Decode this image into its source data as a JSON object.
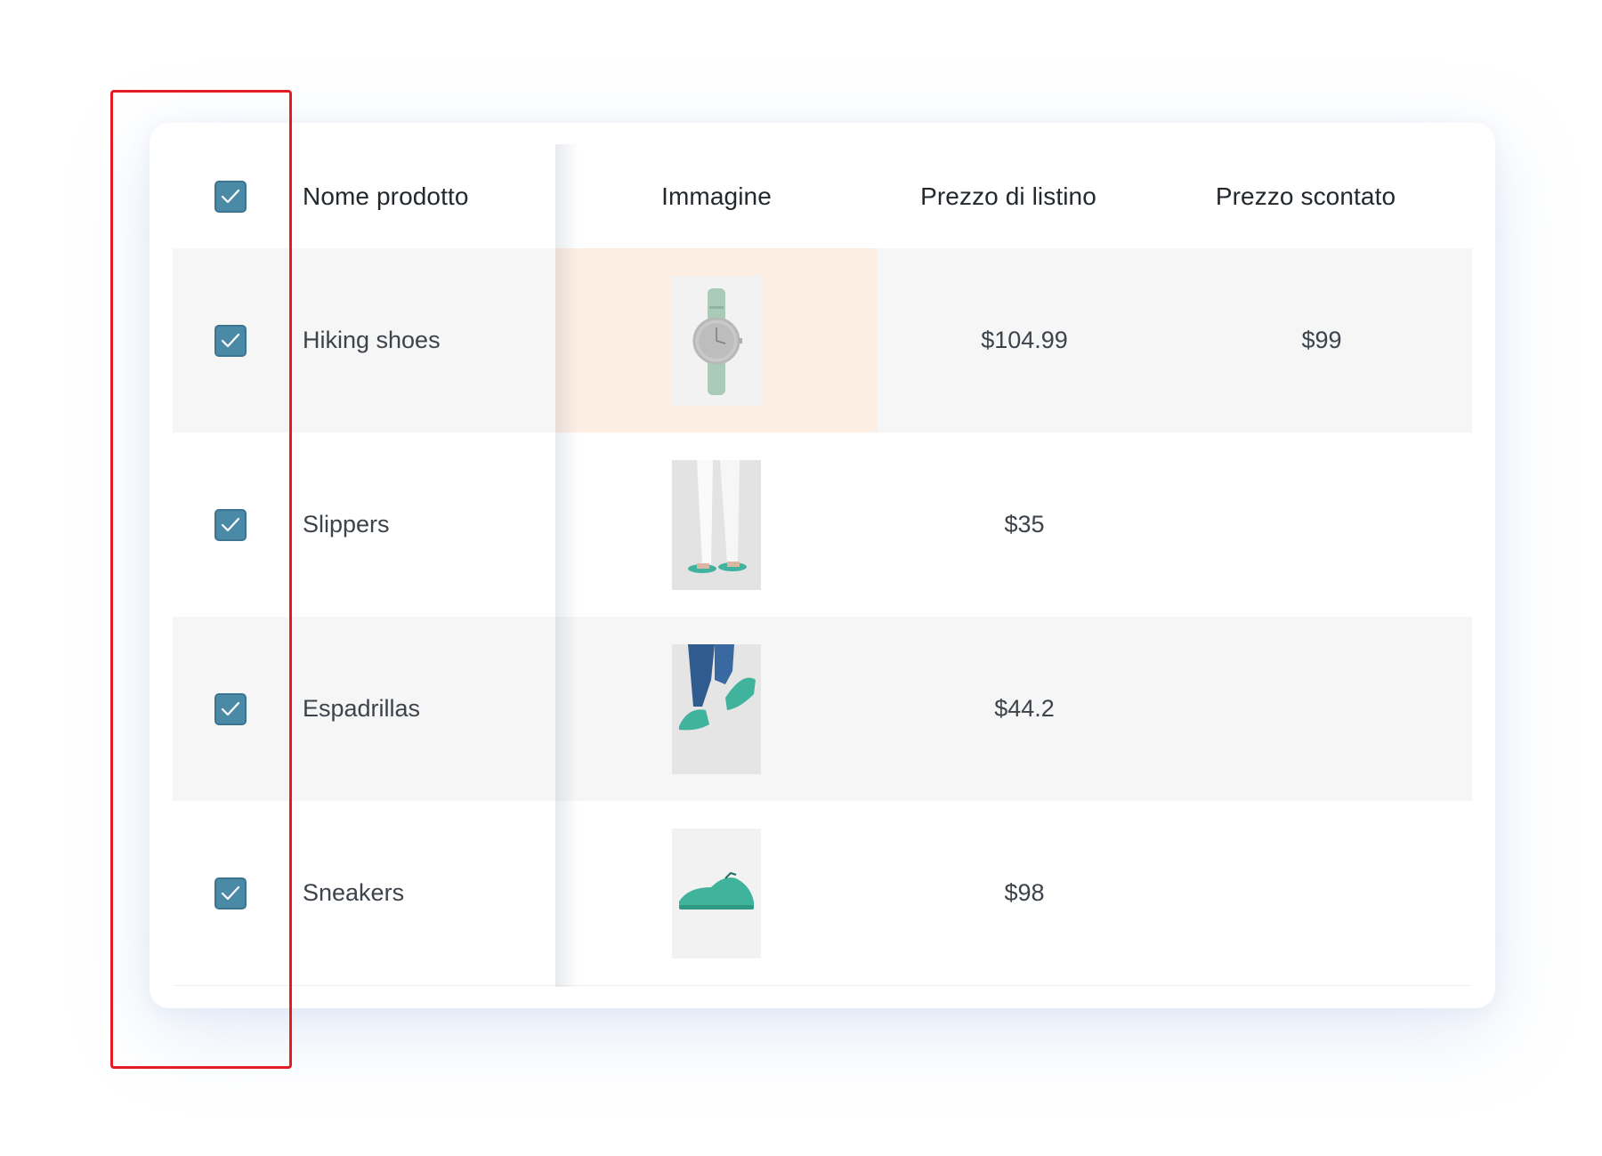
{
  "table": {
    "headers": {
      "name": "Nome prodotto",
      "image": "Immagine",
      "list_price": "Prezzo di listino",
      "discount_price": "Prezzo scontato"
    },
    "select_all_checked": true,
    "rows": [
      {
        "checked": true,
        "name": "Hiking shoes",
        "image_icon": "watch-image",
        "list_price": "$104.99",
        "discount_price": "$99"
      },
      {
        "checked": true,
        "name": "Slippers",
        "image_icon": "slippers-image",
        "list_price": "$35",
        "discount_price": ""
      },
      {
        "checked": true,
        "name": "Espadrillas",
        "image_icon": "espadrilles-image",
        "list_price": "$44.2",
        "discount_price": ""
      },
      {
        "checked": true,
        "name": "Sneakers",
        "image_icon": "sneaker-image",
        "list_price": "$98",
        "discount_price": ""
      }
    ]
  },
  "colors": {
    "checkbox": "#4b8aa6",
    "row_alt": "#f6f6f6",
    "highlight_cell": "#fdeee3",
    "annotation": "#e41c23"
  }
}
